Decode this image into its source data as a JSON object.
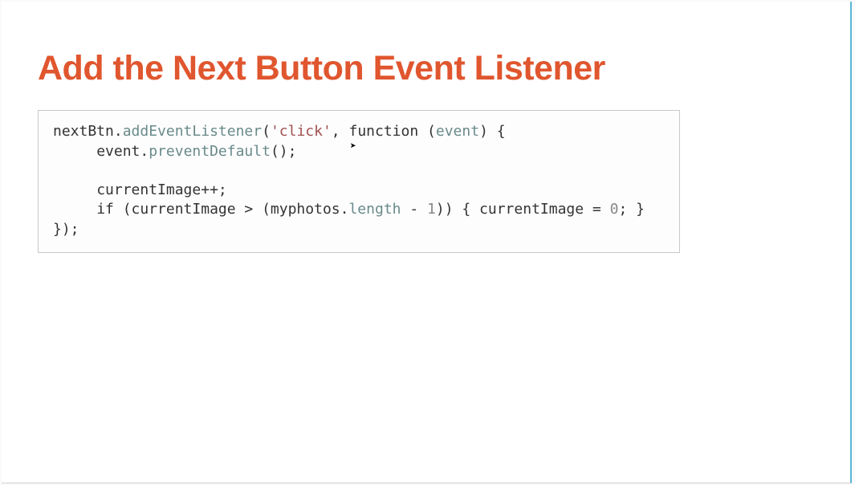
{
  "slide": {
    "title": "Add the Next Button Event Listener"
  },
  "code": {
    "line1": {
      "t1": "nextBtn.",
      "method": "addEventListener",
      "t2": "(",
      "str": "'click'",
      "t3": ", ",
      "kw": "function",
      "t4": " (",
      "param": "event",
      "t5": ") {"
    },
    "line2": {
      "indent": "     ",
      "t1": "event.",
      "method": "preventDefault",
      "t2": "();"
    },
    "line3": "",
    "line4": {
      "indent": "     ",
      "t1": "currentImage++;"
    },
    "line5": {
      "indent": "     ",
      "t1": "if (currentImage > (myphotos.",
      "prop": "length",
      "t2": " - ",
      "num": "1",
      "t3": ")) { currentImage = ",
      "num2": "0",
      "t4": "; }"
    },
    "line6": "});"
  },
  "cursor_glyph": "➤"
}
